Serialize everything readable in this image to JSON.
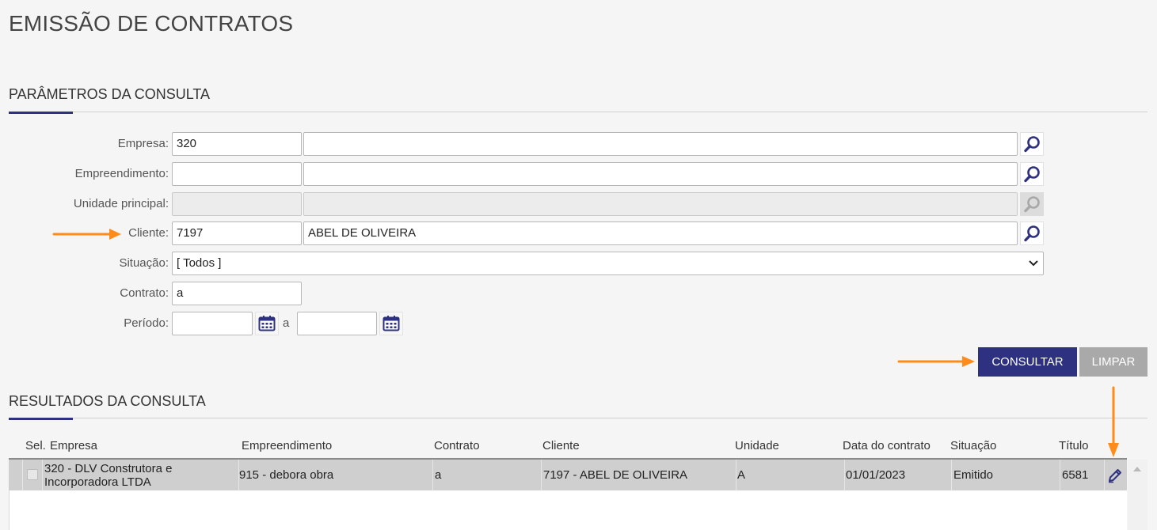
{
  "page": {
    "title": "EMISSÃO DE CONTRATOS"
  },
  "params": {
    "title": "PARÂMETROS DA CONSULTA",
    "empresa": {
      "label": "Empresa:",
      "code": "320",
      "name": ""
    },
    "empreendimento": {
      "label": "Empreendimento:",
      "code": "",
      "name": ""
    },
    "unidade": {
      "label": "Unidade principal:",
      "code": "",
      "name": ""
    },
    "cliente": {
      "label": "Cliente:",
      "code": "7197",
      "name": "ABEL DE OLIVEIRA"
    },
    "situacao": {
      "label": "Situação:",
      "value": "[ Todos ]"
    },
    "contrato": {
      "label": "Contrato:",
      "value": "a"
    },
    "periodo": {
      "label": "Período:",
      "from": "",
      "sep": "a",
      "to": ""
    }
  },
  "actions": {
    "consultar": "CONSULTAR",
    "limpar": "LIMPAR"
  },
  "results": {
    "title": "RESULTADOS DA CONSULTA",
    "columns": {
      "sel": "Sel.",
      "empresa": "Empresa",
      "empreendimento": "Empreendimento",
      "contrato": "Contrato",
      "cliente": "Cliente",
      "unidade": "Unidade",
      "data": "Data do contrato",
      "situacao": "Situação",
      "titulo": "Título"
    },
    "rows": [
      {
        "empresa_line1": "320 - DLV Construtora e",
        "empresa_line2": "Incorporadora LTDA",
        "empreendimento": "915 - debora obra",
        "contrato": "a",
        "cliente": "7197 - ABEL DE OLIVEIRA",
        "unidade": "A",
        "data": "01/01/2023",
        "situacao": "Emitido",
        "titulo": "6581"
      }
    ]
  },
  "colors": {
    "accent": "#2e3180",
    "annotation": "#ff8c1a",
    "row_bg": "#cfcfcf"
  }
}
